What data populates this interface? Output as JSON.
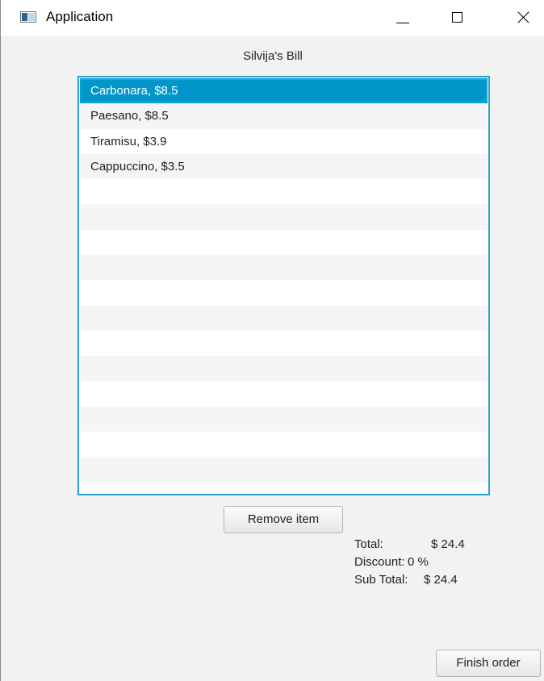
{
  "window": {
    "title": "Application",
    "icon": "app-window-icon"
  },
  "bill": {
    "title": "Silvija's Bill"
  },
  "items": [
    "Carbonara, $8.5",
    "Paesano, $8.5",
    "Tiramisu, $3.9",
    "Cappuccino, $3.5"
  ],
  "selected_index": 0,
  "buttons": {
    "remove": "Remove item",
    "finish": "Finish order"
  },
  "summary": {
    "total_label": "Total:",
    "total_value": "$ 24.4",
    "discount_label": "Discount:",
    "discount_value": "0 %",
    "subtotal_label": "Sub Total:",
    "subtotal_value": "$ 24.4"
  },
  "colors": {
    "selection": "#0096c9",
    "focus_border": "#29a3d4",
    "background": "#f2f2f2"
  }
}
